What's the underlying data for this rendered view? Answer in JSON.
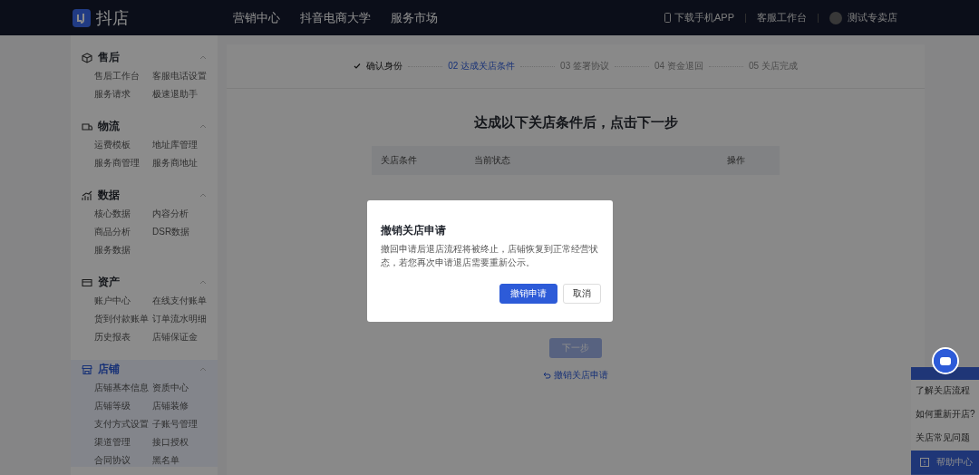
{
  "topbar": {
    "logo": "抖店",
    "nav": [
      "营销中心",
      "抖音电商大学",
      "服务市场"
    ],
    "download": "下载手机APP",
    "service": "客服工作台",
    "shop": "测试专卖店"
  },
  "sidebar": {
    "groups": [
      {
        "title": "售后",
        "selected": false,
        "items": [
          "售后工作台",
          "客服电话设置",
          "服务请求",
          "极速退助手"
        ]
      },
      {
        "title": "物流",
        "selected": false,
        "items": [
          "运费模板",
          "地址库管理",
          "服务商管理",
          "服务商地址"
        ]
      },
      {
        "title": "数据",
        "selected": false,
        "items": [
          "核心数据",
          "内容分析",
          "商品分析",
          "DSR数据",
          "服务数据"
        ]
      },
      {
        "title": "资产",
        "selected": false,
        "items": [
          "账户中心",
          "在线支付账单",
          "货到付款账单",
          "订单流水明细",
          "历史报表",
          "店铺保证金"
        ]
      },
      {
        "title": "店铺",
        "selected": true,
        "items": [
          "店铺基本信息",
          "资质中心",
          "店铺等级",
          "店铺装修",
          "支付方式设置",
          "子账号管理",
          "渠道管理",
          "接口授权",
          "合同协议",
          "黑名单"
        ]
      }
    ]
  },
  "steps": [
    {
      "label": "确认身份",
      "kind": "done"
    },
    {
      "label": "02 达成关店条件",
      "kind": "active"
    },
    {
      "label": "03 签署协议",
      "kind": "pending"
    },
    {
      "label": "04 资金退回",
      "kind": "pending"
    },
    {
      "label": "05 关店完成",
      "kind": "pending"
    }
  ],
  "heading": "达成以下关店条件后，点击下一步",
  "table": {
    "columns": [
      "关店条件",
      "当前状态",
      "操作"
    ]
  },
  "next_button": {
    "label": "下一步",
    "disabled": true
  },
  "revoke_link": "撤销关店申请",
  "dialog": {
    "title": "撤销关店申请",
    "message": "撤回申请后退店流程将被终止，店铺恢复到正常经营状态，若您再次申请退店需要重新公示。",
    "buttons": [
      {
        "label": "撤销申请",
        "kind": "primary"
      },
      {
        "label": "取消",
        "kind": "default"
      }
    ]
  },
  "help": {
    "items": [
      "了解关店流程",
      "如何重新开店?",
      "关店常见问题"
    ],
    "footer": "帮助中心"
  }
}
